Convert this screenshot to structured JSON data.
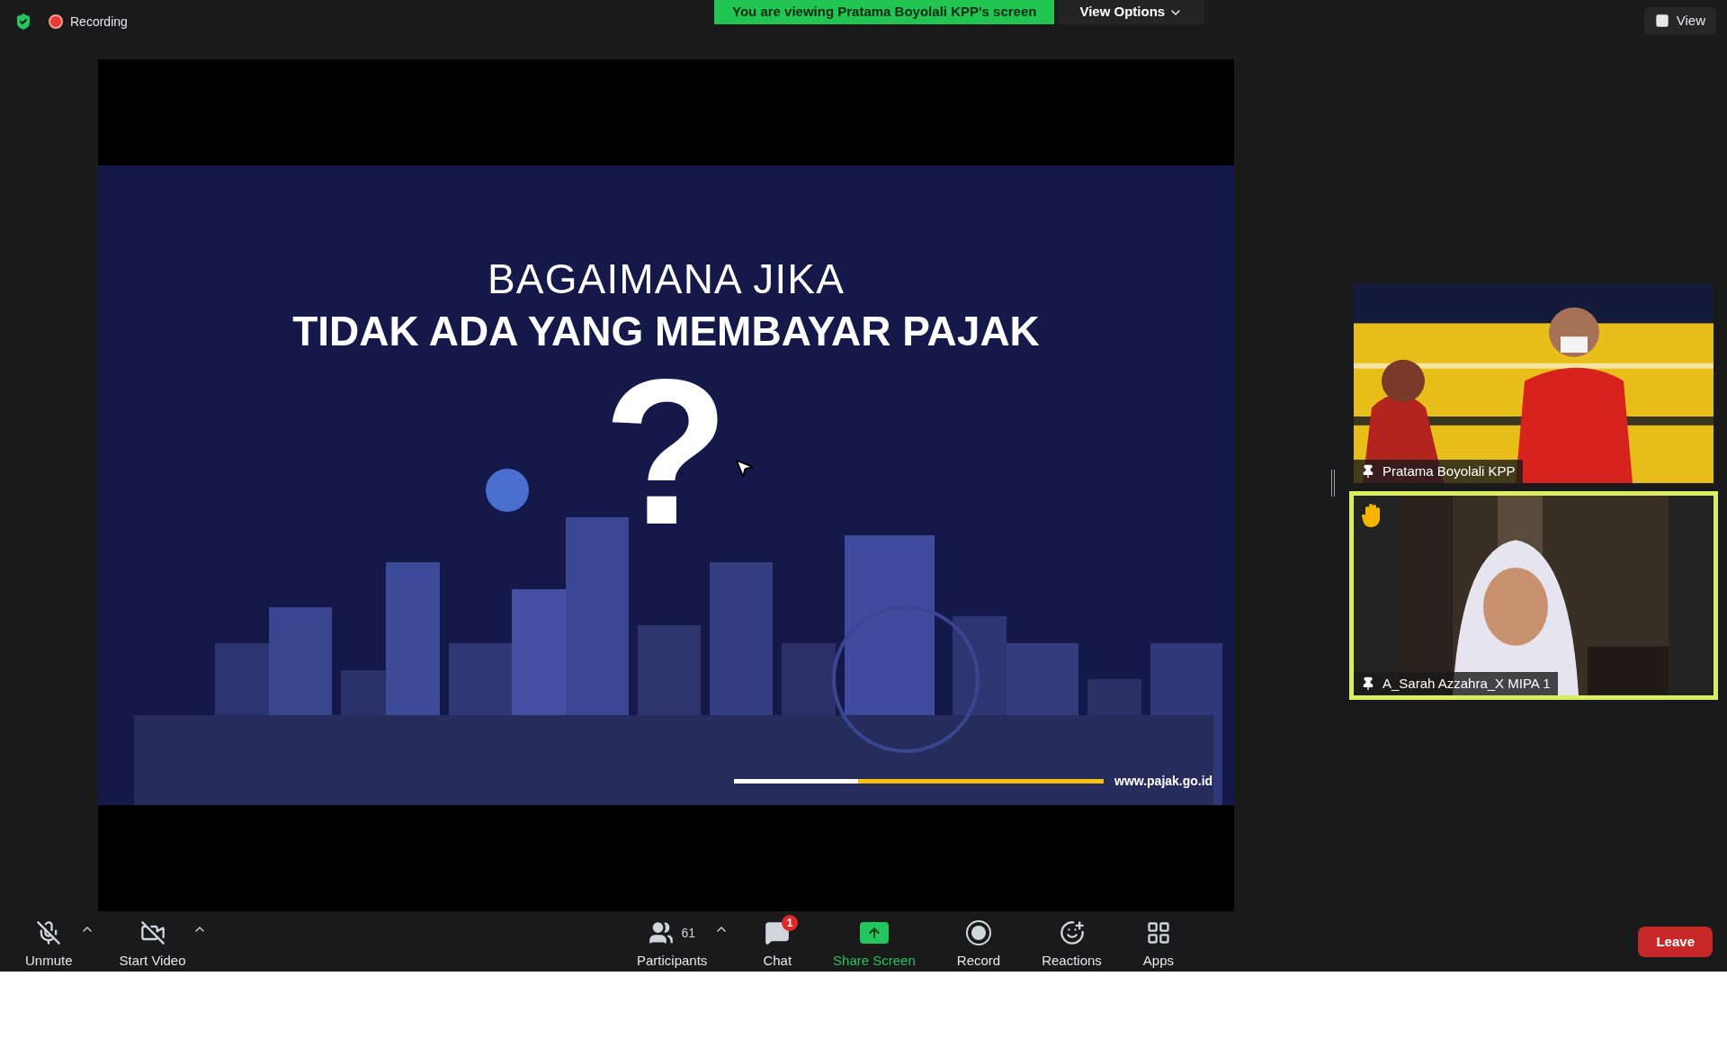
{
  "top_bar": {
    "recording_label": "Recording",
    "share_banner": "You are viewing Pratama Boyolali KPP's screen",
    "view_options": "View Options",
    "view_button": "View"
  },
  "slide": {
    "title_line1": "BAGAIMANA JIKA",
    "title_line2": "TIDAK ADA YANG MEMBAYAR PAJAK",
    "question_mark": "?",
    "url": "www.pajak.go.id"
  },
  "participants": [
    {
      "name": "Pratama Boyolali KPP",
      "kind": "studio",
      "hand_raised": false,
      "active_speaker": false
    },
    {
      "name": "A_Sarah Azzahra_X MIPA 1",
      "kind": "room",
      "hand_raised": true,
      "active_speaker": true
    }
  ],
  "toolbar": {
    "items": [
      {
        "kind": "mic",
        "label": "Unmute",
        "off": true,
        "caret": true
      },
      {
        "kind": "video",
        "label": "Start Video",
        "off": true,
        "caret": true
      },
      {
        "kind": "participants",
        "label": "Participants",
        "count": "61",
        "caret": true
      },
      {
        "kind": "chat",
        "label": "Chat",
        "badge": "1"
      },
      {
        "kind": "share",
        "label": "Share Screen"
      },
      {
        "kind": "record",
        "label": "Record"
      },
      {
        "kind": "reactions",
        "label": "Reactions"
      },
      {
        "kind": "apps",
        "label": "Apps"
      }
    ],
    "leave": "Leave"
  }
}
